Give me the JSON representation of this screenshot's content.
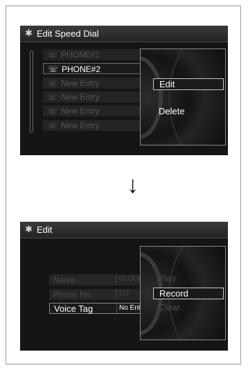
{
  "top_screen": {
    "title": "Edit Speed Dial",
    "list": [
      {
        "label": "PHONE#1",
        "state": "dim"
      },
      {
        "label": "PHONE#2",
        "state": "highlighted"
      },
      {
        "label": "New Entry",
        "state": "dim"
      },
      {
        "label": "New Entry",
        "state": "dim"
      },
      {
        "label": "New Entry",
        "state": "dim"
      },
      {
        "label": "New Entry",
        "state": "dim"
      }
    ],
    "menu": [
      {
        "label": "Edit",
        "state": "selected"
      },
      {
        "label": "Delete",
        "state": "normal"
      }
    ]
  },
  "arrow": "↓",
  "bottom_screen": {
    "title": "Edit",
    "fields": [
      {
        "label": "Name",
        "value": "CLOCK",
        "state": "dim"
      },
      {
        "label": "Phone No.",
        "value": "117",
        "state": "dim"
      },
      {
        "label": "Voice Tag",
        "value": "No Entry",
        "state": "highlighted"
      }
    ],
    "menu": [
      {
        "label": "Play",
        "state": "dim"
      },
      {
        "label": "Record",
        "state": "selected"
      },
      {
        "label": "Clear",
        "state": "dim"
      }
    ]
  }
}
